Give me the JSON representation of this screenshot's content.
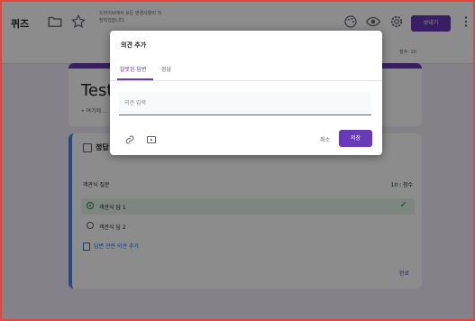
{
  "header": {
    "title": "퀴즈",
    "drive_note": "드라이브에서 모든 변경사항이 저\n장되었습니다",
    "send_label": "보내기",
    "score_note": "점수: 10"
  },
  "form": {
    "title": "Test",
    "description": "• 여기에 ..."
  },
  "question": {
    "header_label": "정답",
    "title": "객관식 질문",
    "points": "10",
    "points_label": "점수",
    "options": [
      {
        "label": "객관식 답 1",
        "correct": true
      },
      {
        "label": "객관식 답 2",
        "correct": false
      }
    ],
    "add_feedback_label": "답변 관련 의견 추가",
    "done_label": "완료"
  },
  "dialog": {
    "title": "의견 추가",
    "tabs": [
      "잘못된 답변",
      "정답"
    ],
    "active_tab": "잘못된 답변",
    "input_placeholder": "의견 입력",
    "input_value": "",
    "cancel_label": "취소",
    "save_label": "저장"
  },
  "colors": {
    "accent": "#673ab7",
    "correct": "#188038",
    "link": "#1a73e8",
    "frame_border": "#e8423a"
  },
  "icons": [
    "folder-icon",
    "star-icon",
    "palette-icon",
    "preview-eye-icon",
    "settings-gear-icon",
    "more-vert-icon",
    "link-icon",
    "video-icon",
    "check-icon"
  ]
}
